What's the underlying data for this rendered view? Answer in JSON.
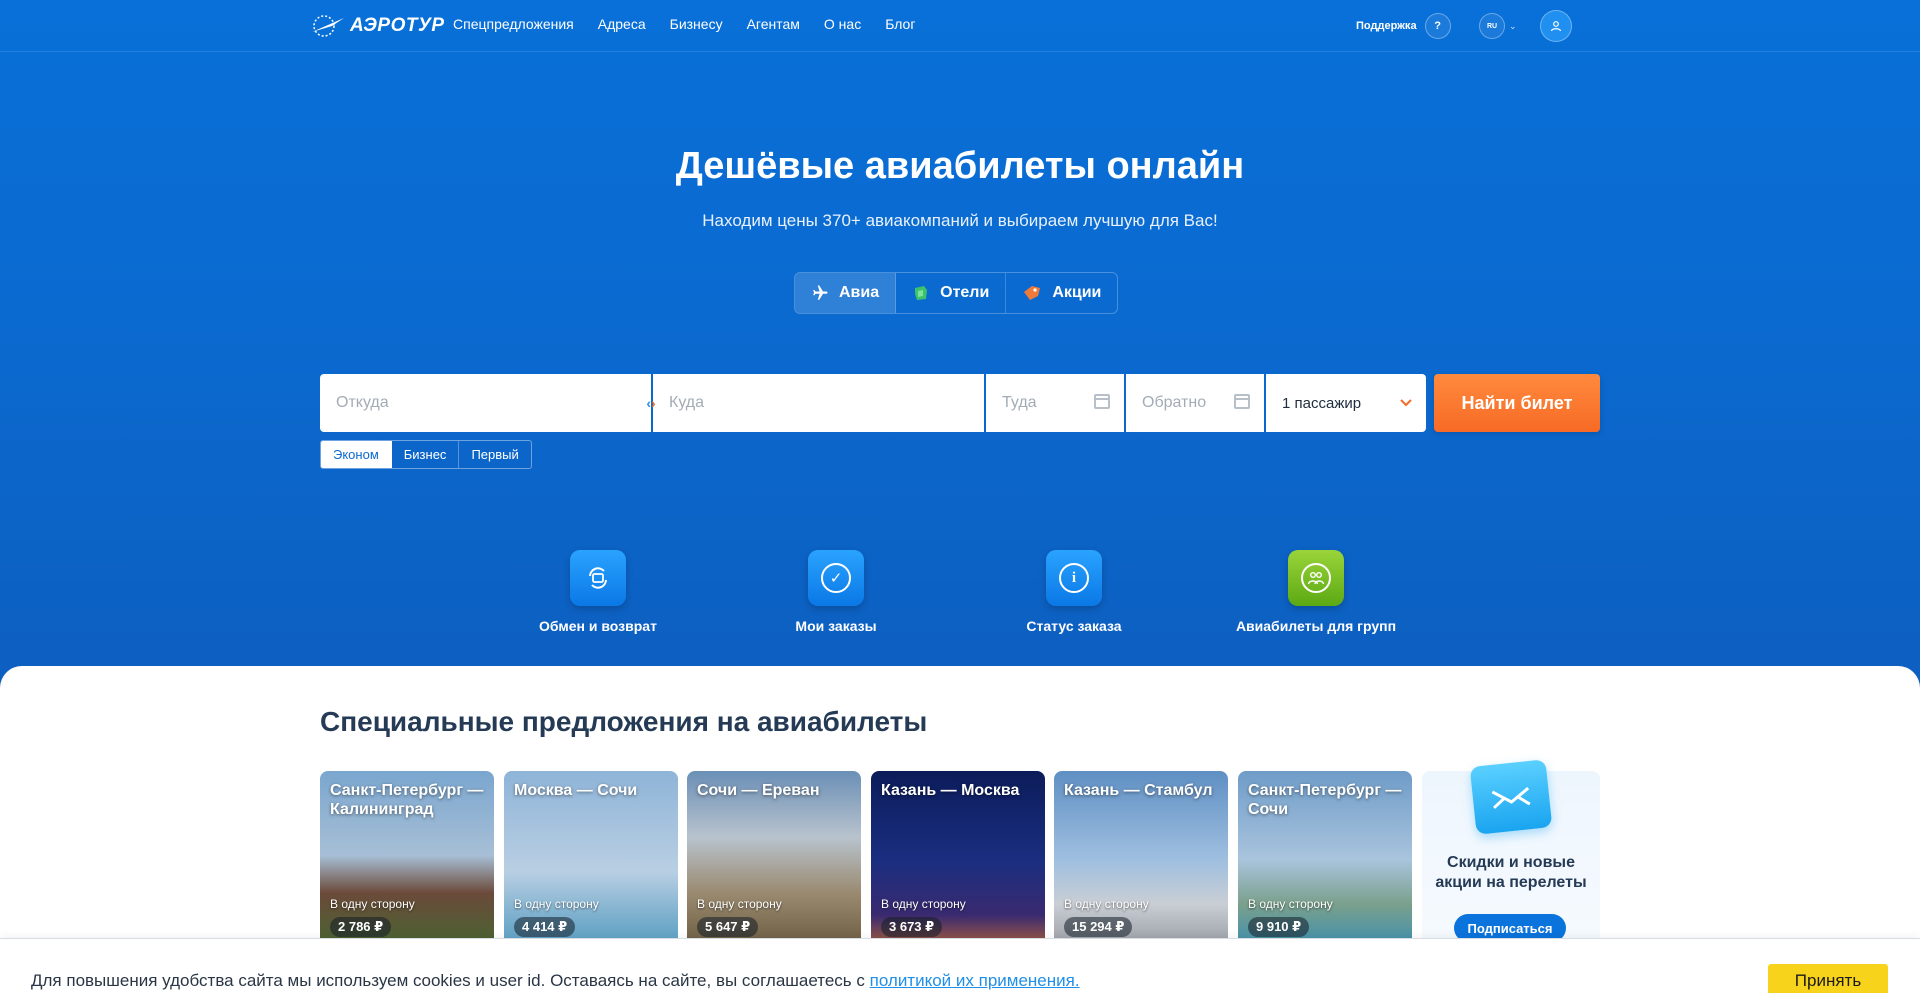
{
  "header": {
    "logo_text": "АЭРОТУР",
    "nav": [
      "Спецпредложения",
      "Адреса",
      "Бизнесу",
      "Агентам",
      "О нас",
      "Блог"
    ],
    "support_label": "Поддержка",
    "support_icon_text": "?",
    "lang": "RU"
  },
  "hero": {
    "title": "Дешёвые авиабилеты онлайн",
    "subtitle": "Находим цены 370+ авиакомпаний и выбираем лучшую для Вас!"
  },
  "tabs": [
    {
      "label": "Авиа",
      "icon": "plane-icon",
      "active": true
    },
    {
      "label": "Отели",
      "icon": "hotel-icon",
      "active": false
    },
    {
      "label": "Акции",
      "icon": "tag-icon",
      "active": false
    }
  ],
  "search": {
    "from_placeholder": "Откуда",
    "to_placeholder": "Куда",
    "depart_placeholder": "Туда",
    "return_placeholder": "Обратно",
    "passengers": "1 пассажир",
    "submit": "Найти билет",
    "classes": [
      {
        "label": "Эконом",
        "active": true
      },
      {
        "label": "Бизнес",
        "active": false
      },
      {
        "label": "Первый",
        "active": false
      }
    ]
  },
  "services": [
    {
      "label": "Обмен и возврат",
      "icon": "exchange-icon"
    },
    {
      "label": "Мои заказы",
      "icon": "check-icon"
    },
    {
      "label": "Статус заказа",
      "icon": "info-icon"
    },
    {
      "label": "Авиабилеты для групп",
      "icon": "group-icon"
    }
  ],
  "offers": {
    "title": "Специальные предложения на авиабилеты",
    "cards": [
      {
        "route": "Санкт-Петербург — Калининград",
        "note": "В одну сторону",
        "price": "2 786 ₽"
      },
      {
        "route": "Москва — Сочи",
        "note": "В одну сторону",
        "price": "4 414 ₽"
      },
      {
        "route": "Сочи — Ереван",
        "note": "В одну сторону",
        "price": "5 647 ₽"
      },
      {
        "route": "Казань — Москва",
        "note": "В одну сторону",
        "price": "3 673 ₽"
      },
      {
        "route": "Казань — Стамбул",
        "note": "В одну сторону",
        "price": "15 294 ₽"
      },
      {
        "route": "Санкт-Петербург — Сочи",
        "note": "В одну сторону",
        "price": "9 910 ₽"
      }
    ],
    "promo_text": "Скидки и новые акции на перелеты",
    "promo_button": "Подписаться"
  },
  "cookie": {
    "text": "Для повышения удобства сайта мы используем cookies и user id. Оставаясь на сайте, вы соглашаетесь с ",
    "link": "политикой их применения.",
    "accept": "Принять"
  },
  "colors": {
    "brand_blue": "#0b6ad0",
    "cta_orange": "#f76a25",
    "accept_yellow": "#f7d31b"
  }
}
